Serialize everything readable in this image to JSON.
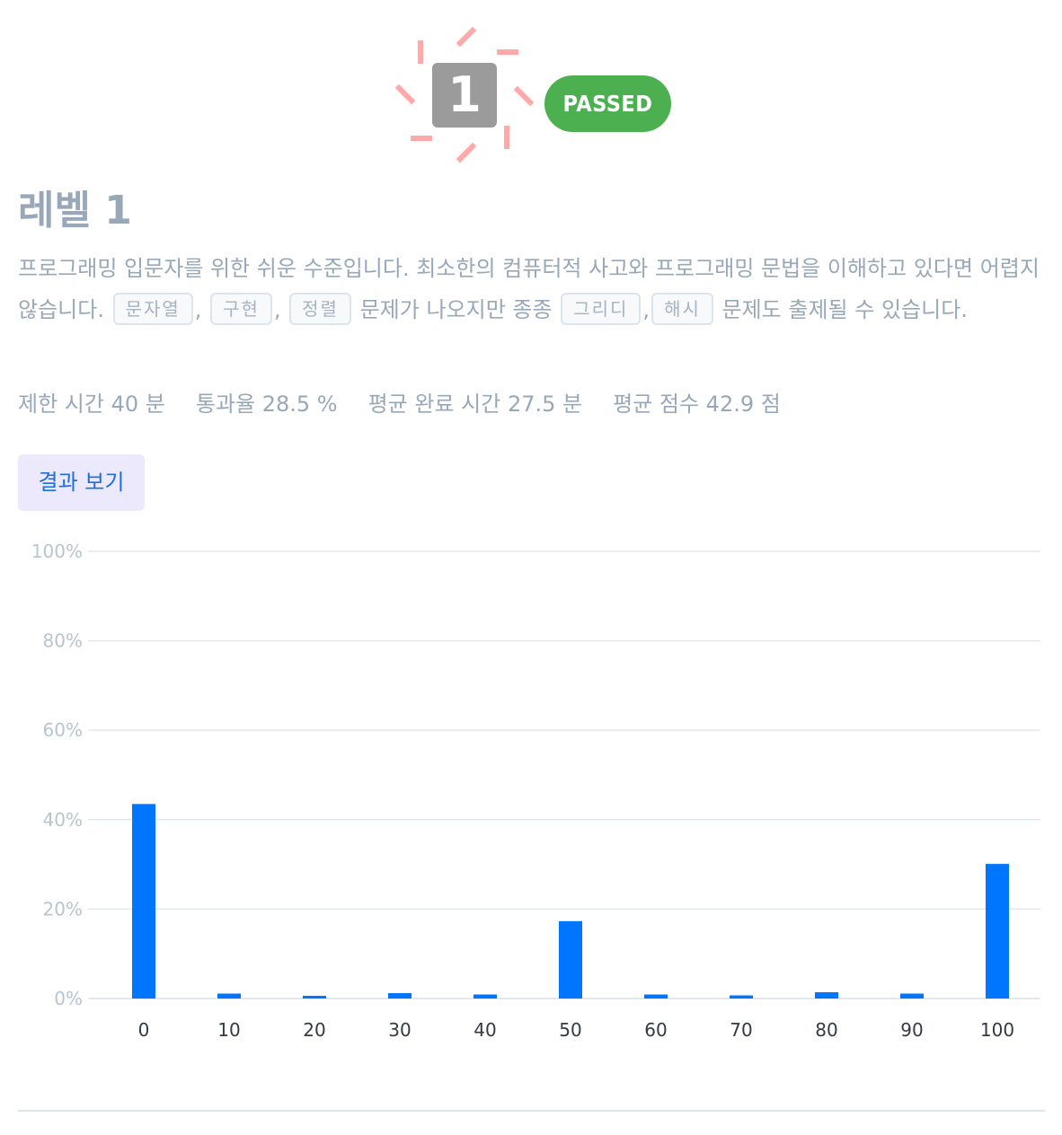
{
  "badge": {
    "level_number": "1",
    "status": "PASSED"
  },
  "title": "레벨 1",
  "description": {
    "intro": "프로그래밍 입문자를 위한 쉬운 수준입니다. 최소한의 컴퓨터적 사고와 프로그래밍 문법을 이해하고 있다면 어렵지 않습니다. ",
    "tags_primary": [
      "문자열",
      "구현",
      "정렬"
    ],
    "middle": " 문제가 나오지만 종종 ",
    "tags_secondary": [
      "그리디",
      "해시"
    ],
    "outro": " 문제도 출제될 수 있습니다.",
    "separator": ","
  },
  "stats": {
    "time_limit": "제한 시간 40 분",
    "pass_rate": "통과율 28.5 %",
    "avg_completion": "평균 완료 시간 27.5 분",
    "avg_score": "평균 점수 42.9 점"
  },
  "result_button": "결과 보기",
  "colors": {
    "accent": "#0076ff",
    "passed": "#4caf50",
    "level_box": "#9b9b9b",
    "burst": "#ffaaa9"
  },
  "chart_data": {
    "type": "bar",
    "categories": [
      "0",
      "10",
      "20",
      "30",
      "40",
      "50",
      "60",
      "70",
      "80",
      "90",
      "100"
    ],
    "values": [
      43.5,
      1.1,
      0.6,
      1.2,
      0.9,
      17.3,
      0.9,
      0.7,
      1.4,
      1.1,
      30.1
    ],
    "ylim": [
      0,
      100
    ],
    "yticks": [
      "0%",
      "20%",
      "40%",
      "60%",
      "80%",
      "100%"
    ],
    "ytick_values": [
      0,
      20,
      40,
      60,
      80,
      100
    ],
    "grid": true,
    "legend": "none",
    "title": "",
    "xlabel": "",
    "ylabel": ""
  }
}
